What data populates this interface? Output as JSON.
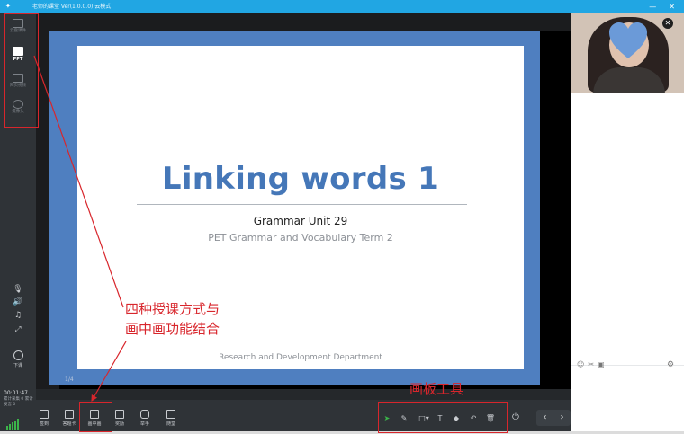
{
  "window": {
    "title": "老师的课堂 Ver(1.0.0.0) 云模式"
  },
  "sidebar": {
    "modes": [
      {
        "label": "云盘课件"
      },
      {
        "label": "PPT"
      },
      {
        "label": "网页视频"
      },
      {
        "label": "摄像头"
      }
    ],
    "end_class_label": "下课",
    "timer": "00:01:47",
    "stats": "累计采集 0 累计发言 0"
  },
  "slide": {
    "title": "Linking words 1",
    "subtitle1": "Grammar Unit 29",
    "subtitle2": "PET Grammar and Vocabulary Term 2",
    "footer": "Research and Development Department",
    "page_indicator": "1/4"
  },
  "bottom_toolbar": {
    "buttons": [
      {
        "label": "签到"
      },
      {
        "label": "答题卡"
      },
      {
        "label": "画中画"
      },
      {
        "label": "奖励"
      },
      {
        "label": "举手"
      },
      {
        "label": "随堂"
      }
    ]
  },
  "annotations": {
    "teaching_modes": "四种授课方式与\n画中画功能结合",
    "board_tools": "画板工具"
  },
  "colors": {
    "titlebar": "#21a6e3",
    "toolbar": "#2f3337",
    "slide_frame": "#4f7fc0",
    "slide_title": "#4577b8",
    "annotation": "#d8262c",
    "active_tool": "#3bb54a"
  }
}
